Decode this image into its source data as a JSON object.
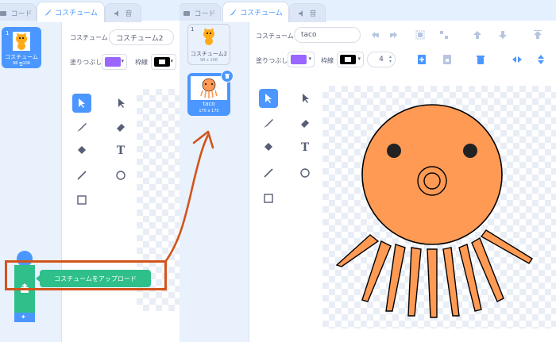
{
  "left_editor": {
    "tabs": [
      {
        "label": "コード"
      },
      {
        "label": "コスチューム"
      },
      {
        "label": "音"
      }
    ],
    "costumes": [
      {
        "number": "1",
        "name": "コスチューム2",
        "size": "98 x 106"
      }
    ],
    "costume_label": "コスチューム",
    "costume_name_value": "コスチューム2",
    "fill_label": "塗りつぶし",
    "outline_label": "枠線",
    "fill_color": "#9966ff",
    "outline_color": "#000000",
    "upload_tooltip": "コスチュームをアップロード"
  },
  "right_editor": {
    "tabs": [
      {
        "label": "コード"
      },
      {
        "label": "コスチューム"
      },
      {
        "label": "音"
      }
    ],
    "costumes": [
      {
        "number": "1",
        "name": "コスチューム2",
        "size": "98 x 106"
      },
      {
        "number": "2",
        "name": "taco",
        "size": "175 x 175"
      }
    ],
    "costume_label": "コスチューム",
    "costume_name_value": "taco",
    "fill_label": "塗りつぶし",
    "outline_label": "枠線",
    "outline_width": "4",
    "fill_color": "#9966ff",
    "outline_color": "#000000"
  },
  "colors": {
    "accent": "#4c97ff",
    "annotation": "#d2541c",
    "upload_green": "#2ebf8a",
    "octopus": "#ff9a55"
  }
}
